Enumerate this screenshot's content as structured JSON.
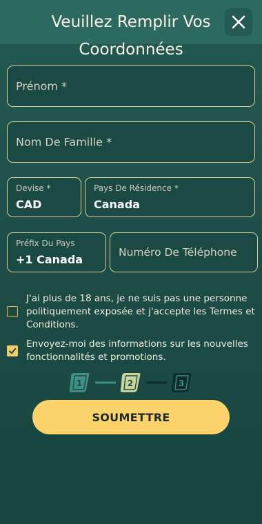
{
  "header": {
    "title": "Veuillez Remplir Vos Coordonnées",
    "close_icon": "close-icon"
  },
  "form": {
    "first_name": {
      "placeholder": "Prénom *",
      "value": ""
    },
    "last_name": {
      "placeholder": "Nom De Famille *",
      "value": ""
    },
    "currency": {
      "label": "Devise *",
      "value": "CAD"
    },
    "country": {
      "label": "Pays De Résidence *",
      "value": "Canada"
    },
    "phone_prefix": {
      "label": "Préfix Du Pays",
      "value": "+1 Canada"
    },
    "phone_number": {
      "placeholder": "Numéro De Téléphone",
      "value": ""
    }
  },
  "consents": [
    {
      "text": "J'ai plus de 18 ans, je ne suis pas une personne politiquement exposée et j'accepte les Termes et Conditions.",
      "checked": false
    },
    {
      "text": "Envoyez-moi des informations sur les nouvelles fonctionnalités et promotions.",
      "checked": true
    }
  ],
  "progress": {
    "steps": [
      "1",
      "2",
      "3"
    ],
    "current_step": 2,
    "colors": {
      "done": "#3e8f84",
      "current": "#c9d39a",
      "pending": "#0f2e2b"
    }
  },
  "submit": {
    "label": "SOUMETTRE"
  },
  "colors": {
    "background": "#1d4c46",
    "border": "#d9cf9a",
    "accent": "#fcd36b",
    "checkbox": "#e4b84a"
  }
}
